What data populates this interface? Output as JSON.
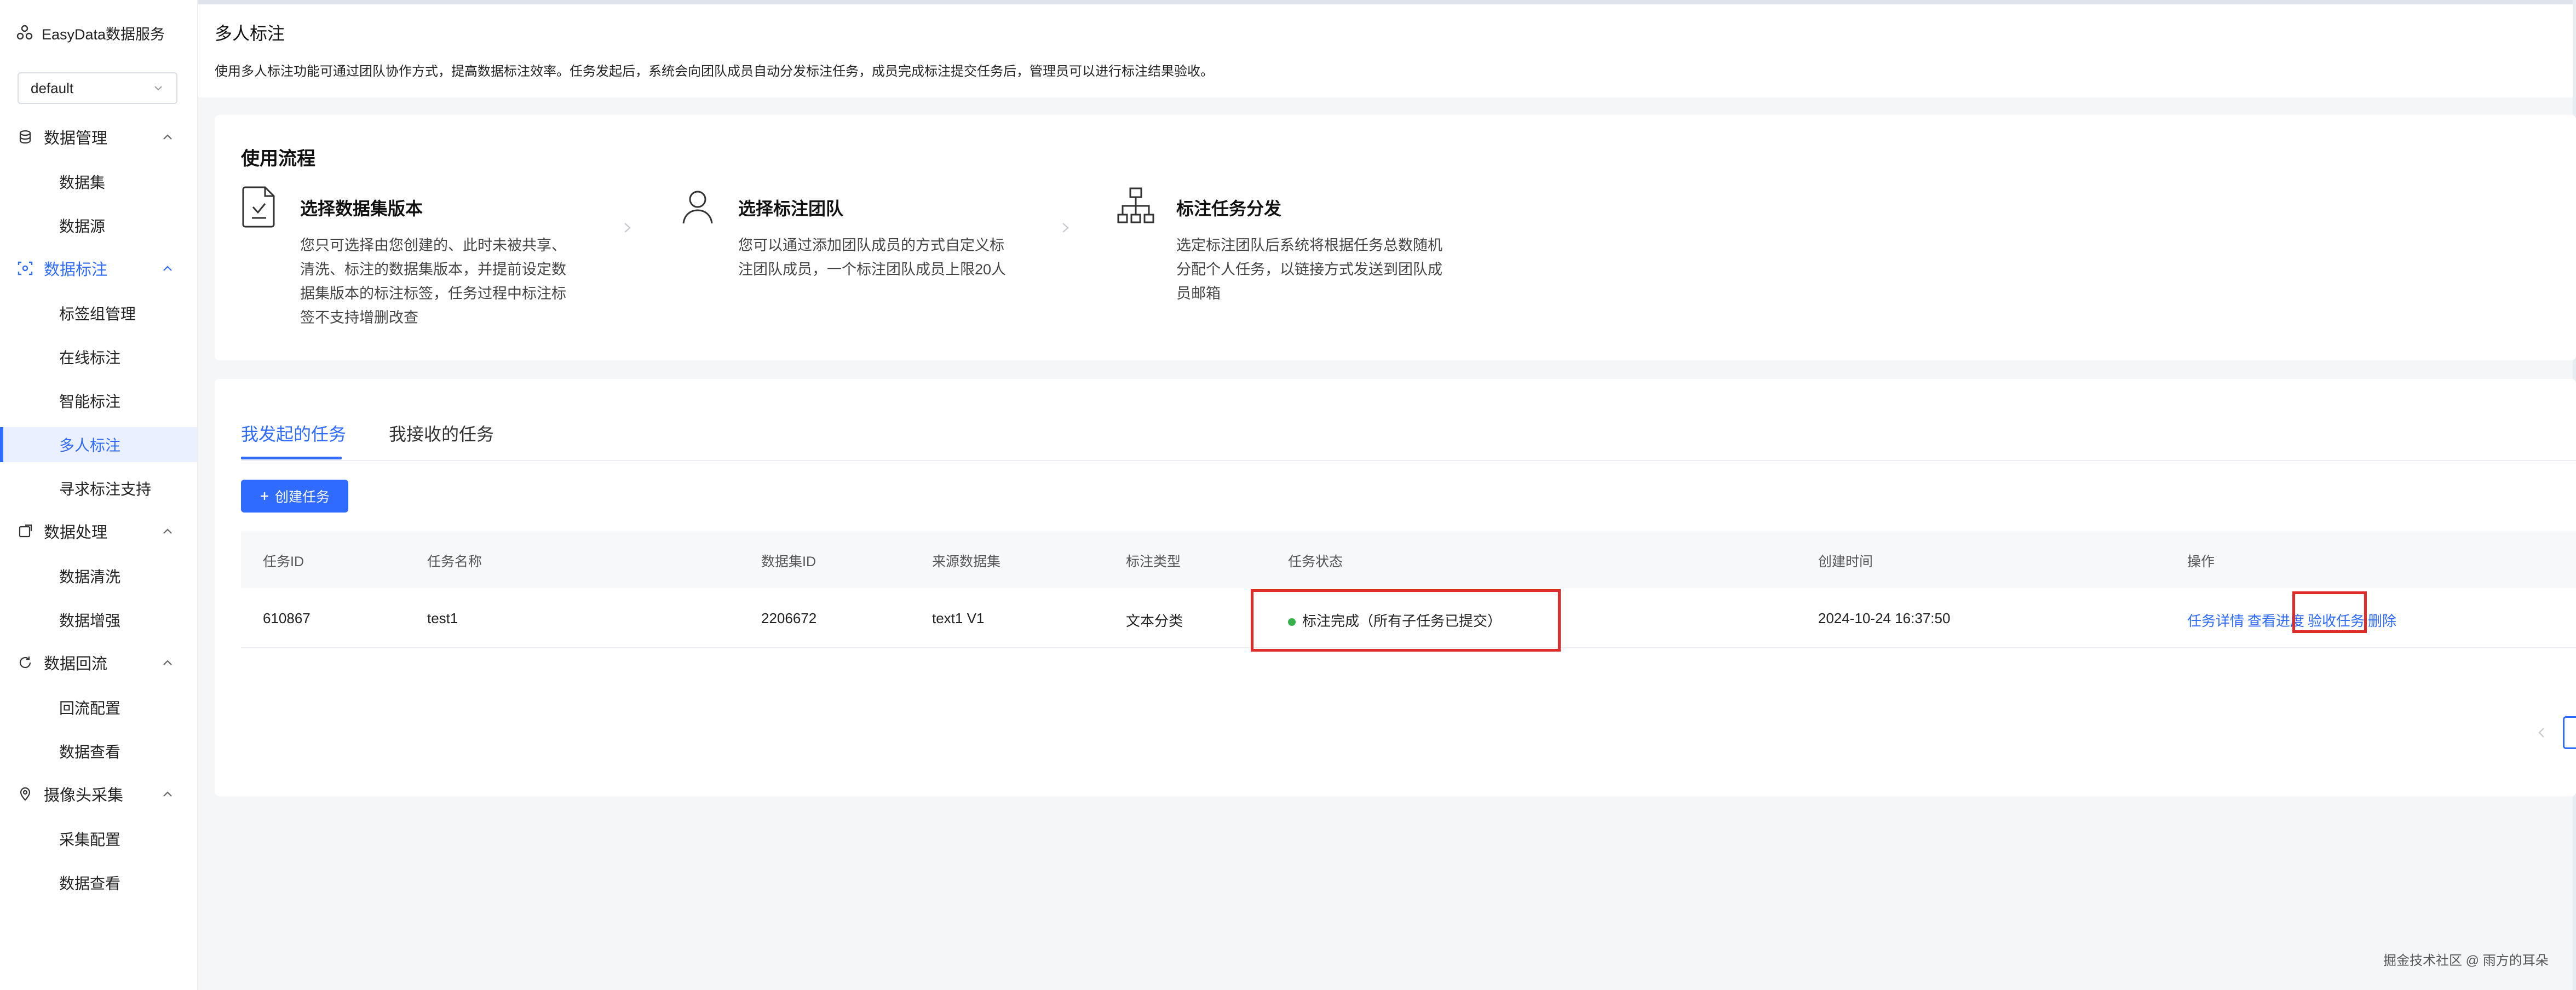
{
  "brand": "EasyData数据服务",
  "workspace": {
    "value": "default"
  },
  "sidebar": {
    "groups": [
      {
        "label": "数据管理",
        "icon": "database-icon",
        "items": [
          "数据集",
          "数据源"
        ]
      },
      {
        "label": "数据标注",
        "icon": "scan-icon",
        "active": true,
        "items": [
          "标签组管理",
          "在线标注",
          "智能标注",
          "多人标注",
          "寻求标注支持"
        ]
      },
      {
        "label": "数据处理",
        "icon": "process-icon",
        "items": [
          "数据清洗",
          "数据增强"
        ]
      },
      {
        "label": "数据回流",
        "icon": "refresh-icon",
        "items": [
          "回流配置",
          "数据查看"
        ]
      },
      {
        "label": "摄像头采集",
        "icon": "location-icon",
        "items": [
          "采集配置",
          "数据查看"
        ]
      }
    ],
    "active_item": "多人标注"
  },
  "header": {
    "title": "多人标注",
    "description": "使用多人标注功能可通过团队协作方式，提高数据标注效率。任务发起后，系统会向团队成员自动分发标注任务，成员完成标注提交任务后，管理员可以进行标注结果验收。"
  },
  "flow": {
    "title": "使用流程",
    "steps": [
      {
        "title": "选择数据集版本",
        "icon": "document-check-icon",
        "desc": "您只可选择由您创建的、此时未被共享、清洗、标注的数据集版本，并提前设定数据集版本的标注标签，任务过程中标注标签不支持增删改查"
      },
      {
        "title": "选择标注团队",
        "icon": "user-icon",
        "desc": "您可以通过添加团队成员的方式自定义标注团队成员，一个标注团队成员上限20人"
      },
      {
        "title": "标注任务分发",
        "icon": "org-chart-icon",
        "desc": "选定标注团队后系统将根据任务总数随机分配个人任务，以链接方式发送到团队成员邮箱"
      }
    ]
  },
  "tabs": [
    "我发起的任务",
    "我接收的任务"
  ],
  "create_button": "创建任务",
  "table": {
    "columns": [
      "任务ID",
      "任务名称",
      "数据集ID",
      "来源数据集",
      "标注类型",
      "任务状态",
      "创建时间",
      "操作"
    ],
    "rows": [
      {
        "id": "610867",
        "name": "test1",
        "dataset_id": "2206672",
        "source": "text1 V1",
        "type": "文本分类",
        "status": "标注完成（所有子任务已提交）",
        "created": "2024-10-24 16:37:50",
        "actions": [
          "任务详情",
          "查看进度",
          "验收任务",
          "删除"
        ]
      }
    ]
  },
  "footer_note": "掘金技术社区 @ 雨方的耳朵",
  "colors": {
    "accent": "#2f6bff",
    "highlight": "#e02b2b",
    "status_ok": "#35b34a"
  }
}
